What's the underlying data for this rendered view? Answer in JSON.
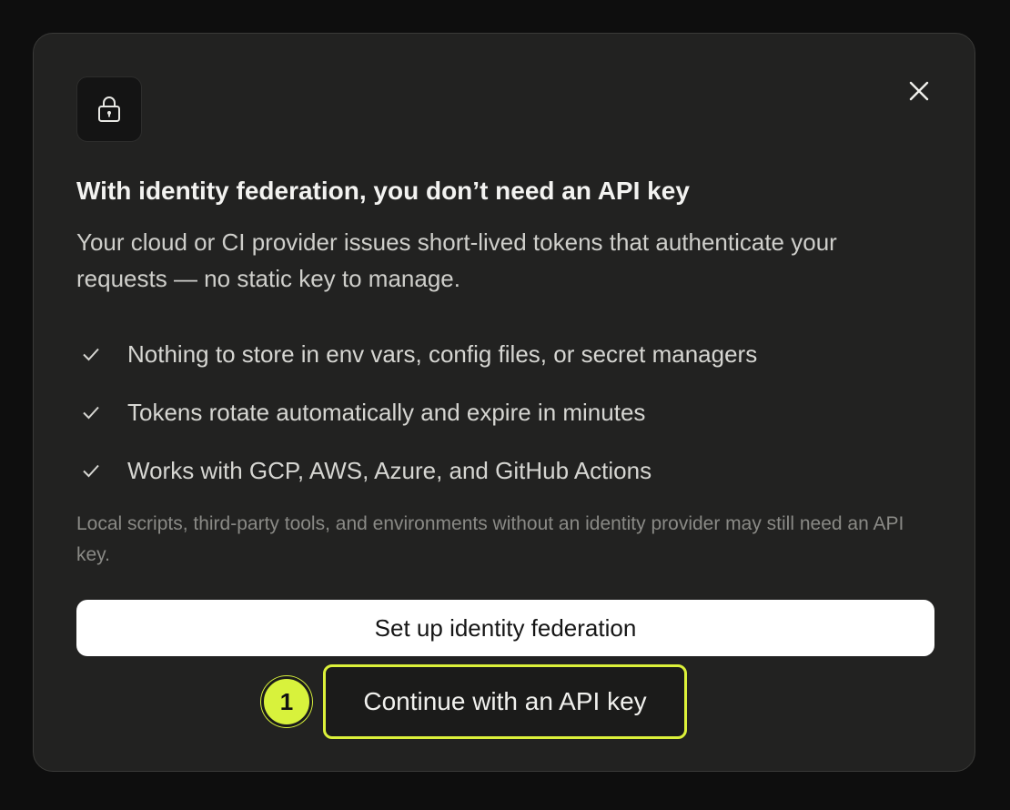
{
  "dialog": {
    "title": "With identity federation, you don’t need an API key",
    "description": "Your cloud or CI provider issues short-lived tokens that authenticate your requests — no static key to manage.",
    "benefits": [
      {
        "icon": "check-icon",
        "text": "Nothing to store in env vars, config files, or secret managers"
      },
      {
        "icon": "check-icon",
        "text": "Tokens rotate automatically and expire in minutes"
      },
      {
        "icon": "check-icon",
        "text": "Works with GCP, AWS, Azure, and GitHub Actions"
      }
    ],
    "note": "Local scripts, third-party tools, and environments without an identity provider may still need an API key.",
    "header_icon": "lock-icon",
    "close_icon": "close-icon"
  },
  "actions": {
    "primary_label": "Set up identity federation",
    "secondary_label": "Continue with an API key",
    "step_badge": "1"
  },
  "colors": {
    "background": "#0e0e0e",
    "dialog_bg": "#222221",
    "accent": "#d8f23c",
    "primary_button_bg": "#ffffff"
  }
}
